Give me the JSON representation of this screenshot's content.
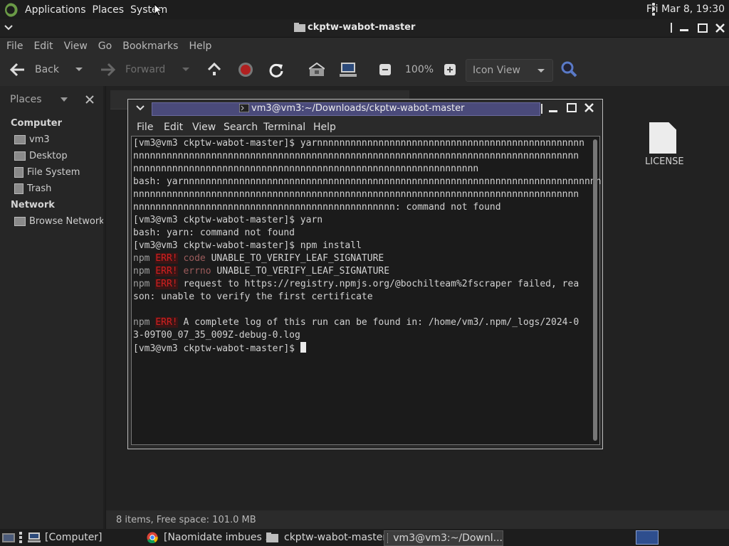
{
  "top_panel": {
    "menus": [
      "Applications",
      "Places",
      "System"
    ],
    "clock": "Fri Mar  8, 19:30"
  },
  "file_manager": {
    "title": "ckptw-wabot-master",
    "menu": [
      "File",
      "Edit",
      "View",
      "Go",
      "Bookmarks",
      "Help"
    ],
    "toolbar": {
      "back": "Back",
      "forward": "Forward",
      "zoom": "100%",
      "view_mode": "Icon View"
    },
    "sidebar": {
      "header": "Places",
      "computer_label": "Computer",
      "computer_items": [
        "vm3",
        "Desktop",
        "File System",
        "Trash"
      ],
      "network_label": "Network",
      "network_items": [
        "Browse Network"
      ]
    },
    "files": [
      {
        "name": "LICENSE"
      }
    ],
    "status": "8 items, Free space: 101.0 MB"
  },
  "terminal": {
    "title": "vm3@vm3:~/Downloads/ckptw-wabot-master",
    "menu": [
      "File",
      "Edit",
      "View",
      "Search",
      "Terminal",
      "Help"
    ],
    "lines": {
      "l1": "[vm3@vm3 ckptw-wabot-master]$ yarnnnnnnnnnnnnnnnnnnnnnnnnnnnnnnnnnnnnnnnnnnnnnnnn",
      "l2": "nnnnnnnnnnnnnnnnnnnnnnnnnnnnnnnnnnnnnnnnnnnnnnnnnnnnnnnnnnnnnnnnnnnnnnnnnnnnnnnn",
      "l3": "nnnnnnnnnnnnnnnnnnnnnnnnnnnnnnnnnnnnnnnnnnnnnnnnnnnnnnnnnnnnnn",
      "l4": "bash: yarnnnnnnnnnnnnnnnnnnnnnnnnnnnnnnnnnnnnnnnnnnnnnnnnnnnnnnnnnnnnnnnnnnnnnnnnnnn",
      "l5": "nnnnnnnnnnnnnnnnnnnnnnnnnnnnnnnnnnnnnnnnnnnnnnnnnnnnnnnnnnnnnnnnnnnnnnnnnnnnnnnn",
      "l6": "nnnnnnnnnnnnnnnnnnnnnnnnnnnnnnnnnnnnnnnnnnnnnnn: command not found",
      "l7": "[vm3@vm3 ckptw-wabot-master]$ yarn",
      "l8": "bash: yarn: command not found",
      "l9": "[vm3@vm3 ckptw-wabot-master]$ npm install",
      "npm": "npm",
      "err": "ERR!",
      "code_key": "code",
      "code_val": "UNABLE_TO_VERIFY_LEAF_SIGNATURE",
      "errno_key": "errno",
      "errno_val": "UNABLE_TO_VERIFY_LEAF_SIGNATURE",
      "req": "request to https://registry.npmjs.org/@bochilteam%2fscraper failed, rea",
      "req2": "son: unable to verify the first certificate",
      "log": "A complete log of this run can be found in: /home/vm3/.npm/_logs/2024-0",
      "log2": "3-09T00_07_35_009Z-debug-0.log",
      "prompt": "[vm3@vm3 ckptw-wabot-master]$ "
    }
  },
  "taskbar": {
    "tasks": [
      "[Computer]",
      "[Naomidate imbues ...",
      "ckptw-wabot-master",
      "vm3@vm3:~/Downl..."
    ]
  }
}
